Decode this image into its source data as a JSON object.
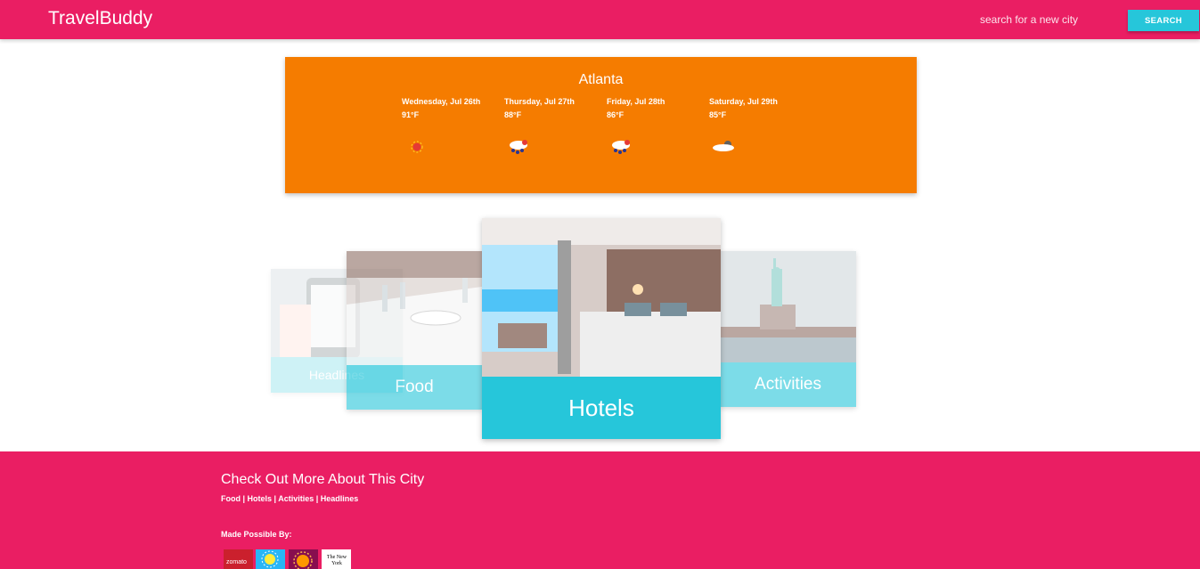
{
  "navbar": {
    "brand": "TravelBuddy",
    "search_placeholder": "search for a new city",
    "search_button": "SEARCH"
  },
  "weather": {
    "city": "Atlanta",
    "days": [
      {
        "date": "Wednesday, Jul 26th",
        "temp": "91°F",
        "icon": "sun-icon"
      },
      {
        "date": "Thursday, Jul 27th",
        "temp": "88°F",
        "icon": "rain-storm-icon"
      },
      {
        "date": "Friday, Jul 28th",
        "temp": "86°F",
        "icon": "rain-storm-icon"
      },
      {
        "date": "Saturday, Jul 29th",
        "temp": "85°F",
        "icon": "partly-cloudy-icon"
      }
    ]
  },
  "carousel": {
    "cards": [
      {
        "label": "Headlines",
        "image": "newspaper-phone-photo"
      },
      {
        "label": "Food",
        "image": "restaurant-table-photo"
      },
      {
        "label": "Hotels",
        "image": "hotel-room-photo"
      },
      {
        "label": "Activities",
        "image": "statue-of-liberty-photo"
      }
    ]
  },
  "footer": {
    "title": "Check Out More About This City",
    "links": [
      "Food",
      "Hotels",
      "Activities",
      "Headlines"
    ],
    "separator": " | ",
    "made_possible": "Made Possible By:",
    "logos": [
      {
        "name": "zomato-logo",
        "text": "zomato"
      },
      {
        "name": "weather-api-logo",
        "text": ""
      },
      {
        "name": "sun-api-logo",
        "text": ""
      },
      {
        "name": "nytimes-logo",
        "text": "The New York"
      }
    ]
  },
  "colors": {
    "primary": "#ea1e63",
    "accent": "#26c6da",
    "weather_card": "#f57c00"
  }
}
